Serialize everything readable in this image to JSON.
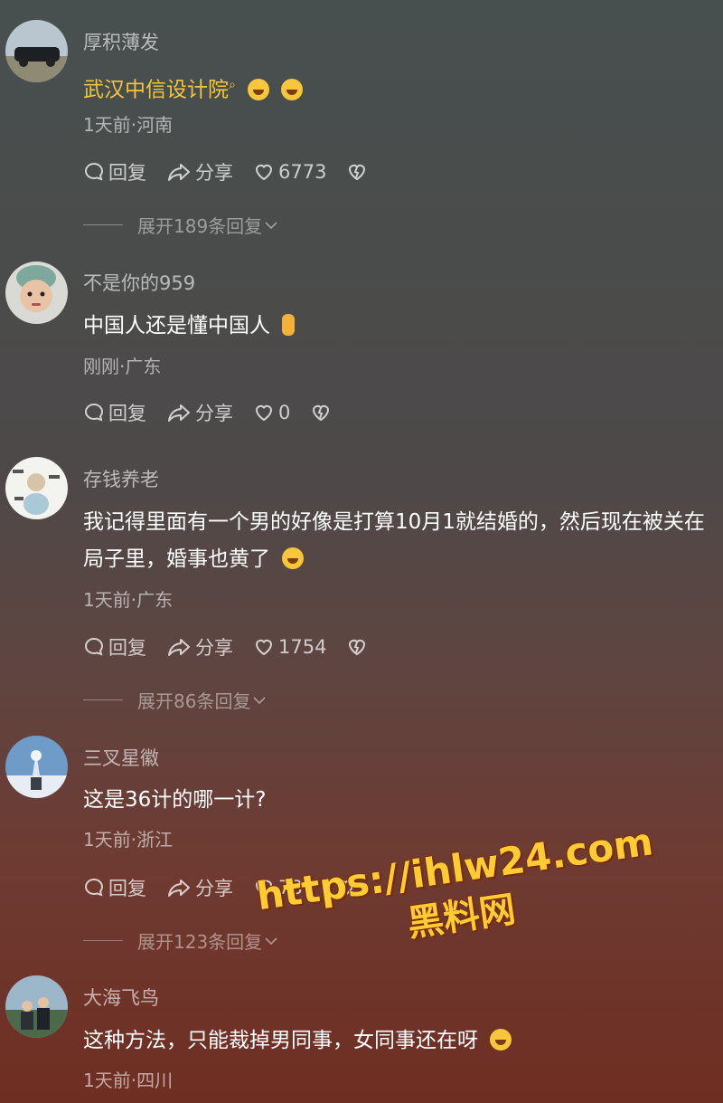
{
  "comments": [
    {
      "username": "厚积薄发",
      "content": "武汉中信设计院",
      "search_mark": "⌕",
      "meta": "1天前·河南",
      "reply_label": "回复",
      "share_label": "分享",
      "likes": "6773",
      "expand_label": "展开189条回复"
    },
    {
      "username": "不是你的959",
      "content": "中国人还是懂中国人",
      "meta": "刚刚·广东",
      "reply_label": "回复",
      "share_label": "分享",
      "likes": "0"
    },
    {
      "username": "存钱养老",
      "content": "我记得里面有一个男的好像是打算10月1就结婚的，然后现在被关在局子里，婚事也黄了",
      "meta": "1天前·广东",
      "reply_label": "回复",
      "share_label": "分享",
      "likes": "1754",
      "expand_label": "展开86条回复"
    },
    {
      "username": "三叉星徽",
      "content": "这是36计的哪一计?",
      "meta": "1天前·浙江",
      "reply_label": "回复",
      "share_label": "分享",
      "likes": "787",
      "expand_label": "展开123条回复"
    },
    {
      "username": "大海飞鸟",
      "content": "这种方法，只能裁掉男同事，女同事还在呀",
      "meta": "1天前·四川"
    }
  ],
  "watermark": {
    "line1": "https://ihlw24.com",
    "line2": "黑料网"
  },
  "icons": {
    "reply": "comment-bubble-icon",
    "share": "share-arrow-icon",
    "like": "heart-icon",
    "dislike": "broken-heart-icon",
    "emoji_laugh": "laughing-emoji-icon",
    "emoji_fingers": "crossed-fingers-emoji-icon"
  },
  "colors": {
    "link": "#f4c63a",
    "watermark": "#ffcc33"
  }
}
